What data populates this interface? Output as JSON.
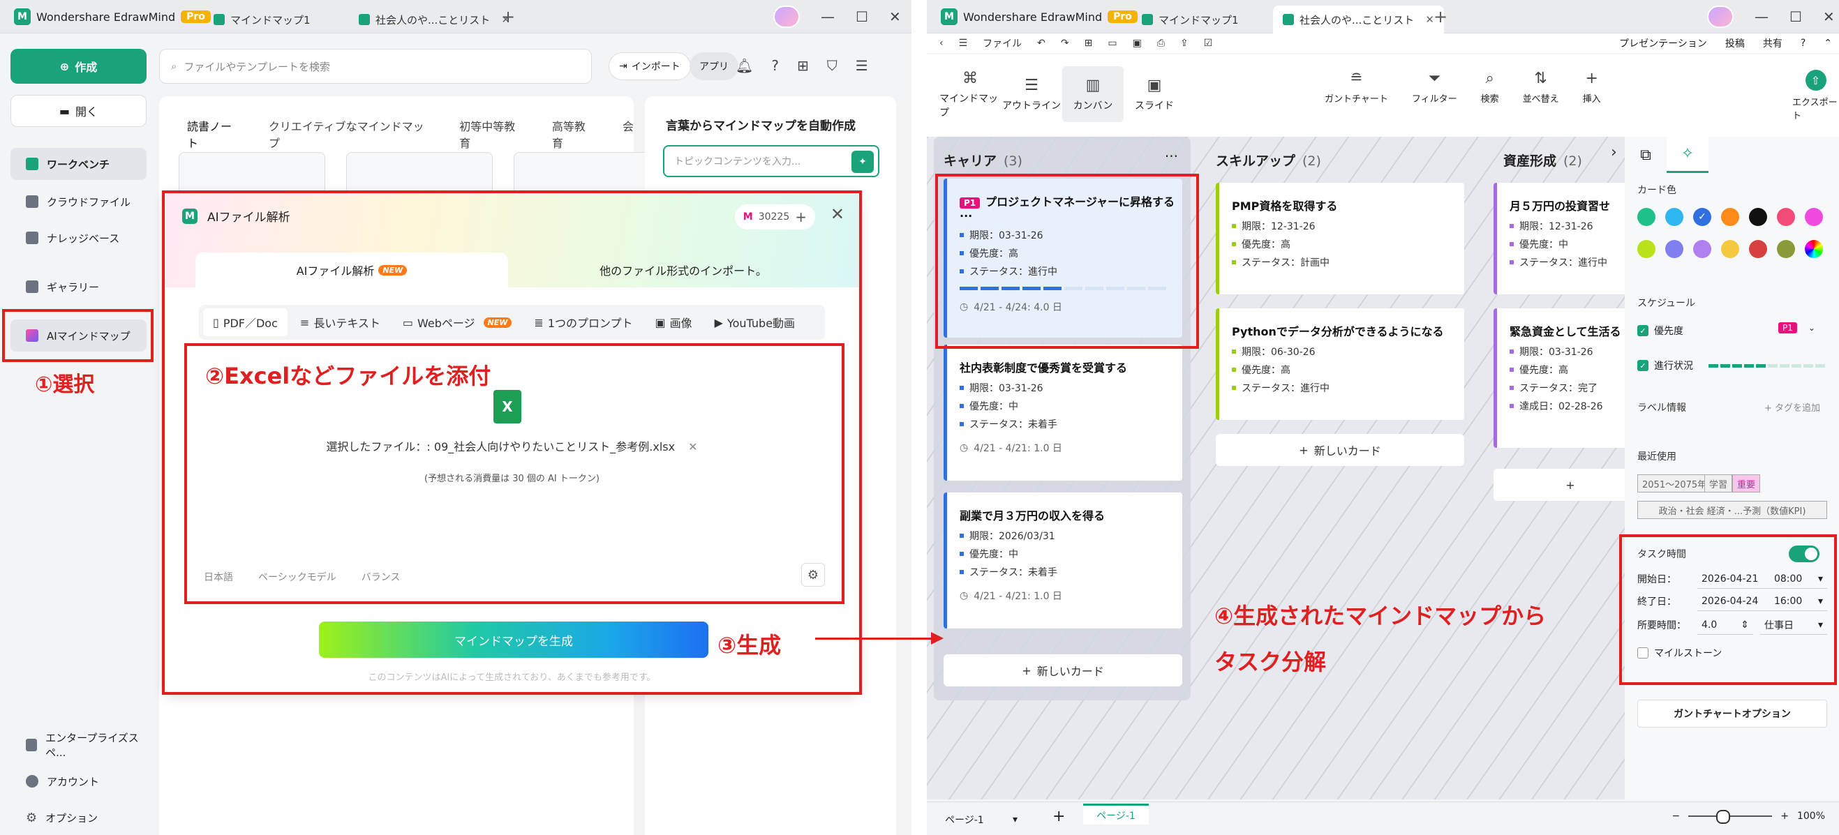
{
  "left_window": {
    "app_name": "Wondershare EdrawMind",
    "pro": "Pro",
    "tabs": [
      "マインドマップ1",
      "社会人のや...ことリスト"
    ],
    "sidebar": {
      "create": "作成",
      "open": "開く",
      "items": [
        "ワークベンチ",
        "クラウドファイル",
        "ナレッジベース",
        "ギャラリー",
        "AIマインドマップ"
      ],
      "bottom": [
        "エンタープライズスペ...",
        "アカウント",
        "オプション"
      ]
    },
    "search_placeholder": "ファイルやテンプレートを検索",
    "import": "インポート",
    "app": "アプリ",
    "category_tabs": [
      "読書ノート",
      "クリエイティブなマインドマップ",
      "初等中等教育",
      "高等教育",
      "会"
    ],
    "right_panel": {
      "title": "言葉からマインドマップを自動作成",
      "placeholder": "トピックコンテンツを入力..."
    },
    "dialog": {
      "title": "AIファイル解析",
      "credits": "30225",
      "tab_ai": "AIファイル解析",
      "new_badge": "NEW",
      "tab_other": "他のファイル形式のインポート。",
      "subtabs": [
        "PDF／Doc",
        "長いテキスト",
        "Webページ",
        "1つのプロンプト",
        "画像",
        "YouTube動画"
      ],
      "file_icon": "X",
      "selected_file": "選択したファイル：: 09_社会人向けやりたいことリスト_参考例.xlsx",
      "tokens": "(予想される消費量は 30 個の AI トークン)",
      "options": [
        "日本語",
        "ベーシックモデル",
        "バランス"
      ],
      "generate": "マインドマップを生成",
      "disclaimer": "このコンテンツはAIによって生成されており、あくまでも参考用です。"
    }
  },
  "right_window": {
    "app_name": "Wondershare EdrawMind",
    "pro": "Pro",
    "tabs": [
      "マインドマップ1",
      "社会人のや...ことリスト"
    ],
    "menu_file": "ファイル",
    "menu_right": [
      "プレゼンテーション",
      "投稿",
      "共有"
    ],
    "views": [
      "マインドマップ",
      "アウトライン",
      "カンバン",
      "スライド"
    ],
    "tools": [
      "ガントチャート",
      "フィルター",
      "検索",
      "並べ替え",
      "挿入"
    ],
    "export": "エクスポート",
    "columns": [
      {
        "name": "キャリア",
        "count": "(3)"
      },
      {
        "name": "スキルアップ",
        "count": "(2)"
      },
      {
        "name": "資産形成",
        "count": "(2)"
      }
    ],
    "cards": {
      "c1": {
        "badge": "P1",
        "title": "プロジェクトマネージャーに昇格する",
        "rows": [
          "期限：03-31-26",
          "優先度：高",
          "ステータス：進行中"
        ],
        "date": "4/21 - 4/24: 4.0 日"
      },
      "c2": {
        "title": "社内表彰制度で優秀賞を受賞する",
        "rows": [
          "期限：03-31-26",
          "優先度：中",
          "ステータス：未着手"
        ],
        "date": "4/21 - 4/21: 1.0 日"
      },
      "c3": {
        "title": "副業で月３万円の収入を得る",
        "rows": [
          "期限：2026/03/31",
          "優先度：中",
          "ステータス：未着手"
        ],
        "date": "4/21 - 4/21: 1.0 日"
      },
      "s1": {
        "title": "PMP資格を取得する",
        "rows": [
          "期限：12-31-26",
          "優先度：高",
          "ステータス：計画中"
        ]
      },
      "s2": {
        "title": "Pythonでデータ分析ができるようになる",
        "rows": [
          "期限：06-30-26",
          "優先度：高",
          "ステータス：進行中"
        ]
      },
      "a1": {
        "title": "月５万円の投資習せ",
        "rows": [
          "期限：12-31-26",
          "優先度：中",
          "ステータス：進行中"
        ]
      },
      "a2": {
        "title": "緊急資金として生活る",
        "rows": [
          "期限：03-31-26",
          "優先度：高",
          "ステータス：完了",
          "達成日：02-28-26"
        ]
      }
    },
    "progress_fraction": 0.5,
    "new_card": "新しいカード",
    "props": {
      "card_color": "カード色",
      "schedule": "スケジュール",
      "priority": "優先度",
      "priority_badge": "P1",
      "progress": "進行状況",
      "label_info": "ラベル情報",
      "add_tag": "+ タグを追加",
      "recent": "最近使用",
      "tags": [
        "2051～2075年",
        "学習",
        "重要"
      ],
      "tag_long": "政治・社会 経済・...予測（数値KPI)",
      "task_time": "タスク時間",
      "start_label": "開始日：",
      "start_date": "2026-04-21",
      "start_time": "08:00",
      "end_label": "終了日：",
      "end_date": "2026-04-24",
      "end_time": "16:00",
      "duration_label": "所要時間：",
      "duration": "4.0",
      "duration_unit": "仕事日",
      "milestone": "マイルストーン",
      "gantt_opt": "ガントチャートオプション"
    },
    "page": "ページ-1",
    "page_tab": "ページ-1",
    "zoom": "100%"
  },
  "annotations": {
    "a1": "①選択",
    "a2": "②Excelなどファイルを添付",
    "a3": "③生成",
    "a4_line1": "④生成されたマインドマップから",
    "a4_line2": "タスク分解"
  },
  "colors": {
    "accent": "#1aa37a",
    "annotation_red": "#e02020",
    "card_blue": "#2f6fe0",
    "card_green": "#9acd1a",
    "card_purple": "#a66be0"
  }
}
